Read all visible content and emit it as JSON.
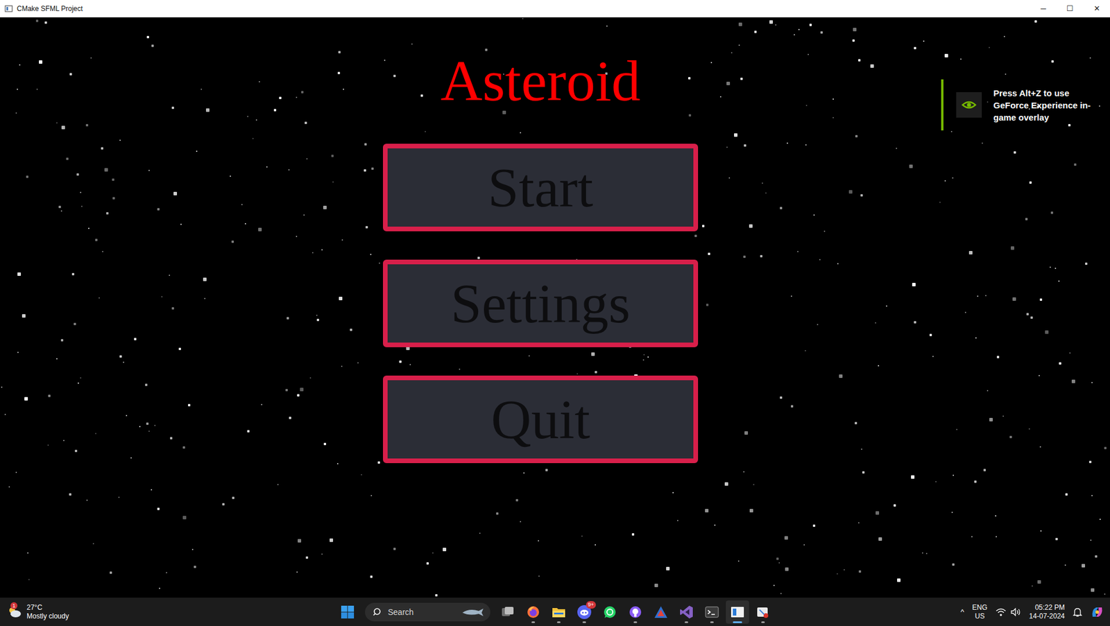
{
  "window": {
    "title": "CMake SFML Project",
    "controls": [
      {
        "glyph": "─"
      },
      {
        "glyph": "☐"
      },
      {
        "glyph": "✕"
      }
    ]
  },
  "game": {
    "title": "Asteroid",
    "buttons": [
      {
        "label": "Start"
      },
      {
        "label": "Settings"
      },
      {
        "label": "Quit"
      }
    ]
  },
  "overlay": {
    "text": "Press Alt+Z to use GeForce Experience in-game overlay"
  },
  "taskbar": {
    "weather": {
      "temp": "27°C",
      "condition": "Mostly cloudy",
      "badge": "1"
    },
    "search": {
      "placeholder": "Search"
    },
    "apps": [
      {
        "kind": "taskview",
        "running": false,
        "active": false
      },
      {
        "kind": "firefox",
        "running": true,
        "active": false
      },
      {
        "kind": "explorer",
        "running": true,
        "active": false
      },
      {
        "kind": "discord",
        "running": true,
        "active": false,
        "badge": "9+"
      },
      {
        "kind": "whatsapp",
        "running": false,
        "active": false
      },
      {
        "kind": "github",
        "running": true,
        "active": false
      },
      {
        "kind": "triangle",
        "running": false,
        "active": false
      },
      {
        "kind": "vs",
        "running": true,
        "active": false
      },
      {
        "kind": "terminal",
        "running": true,
        "active": false
      },
      {
        "kind": "window",
        "running": true,
        "active": true
      },
      {
        "kind": "snip",
        "running": true,
        "active": false
      }
    ],
    "tray": {
      "chevron": "^",
      "language": "ENG",
      "region": "US",
      "time": "05:22 PM",
      "date": "14-07-2024"
    }
  }
}
